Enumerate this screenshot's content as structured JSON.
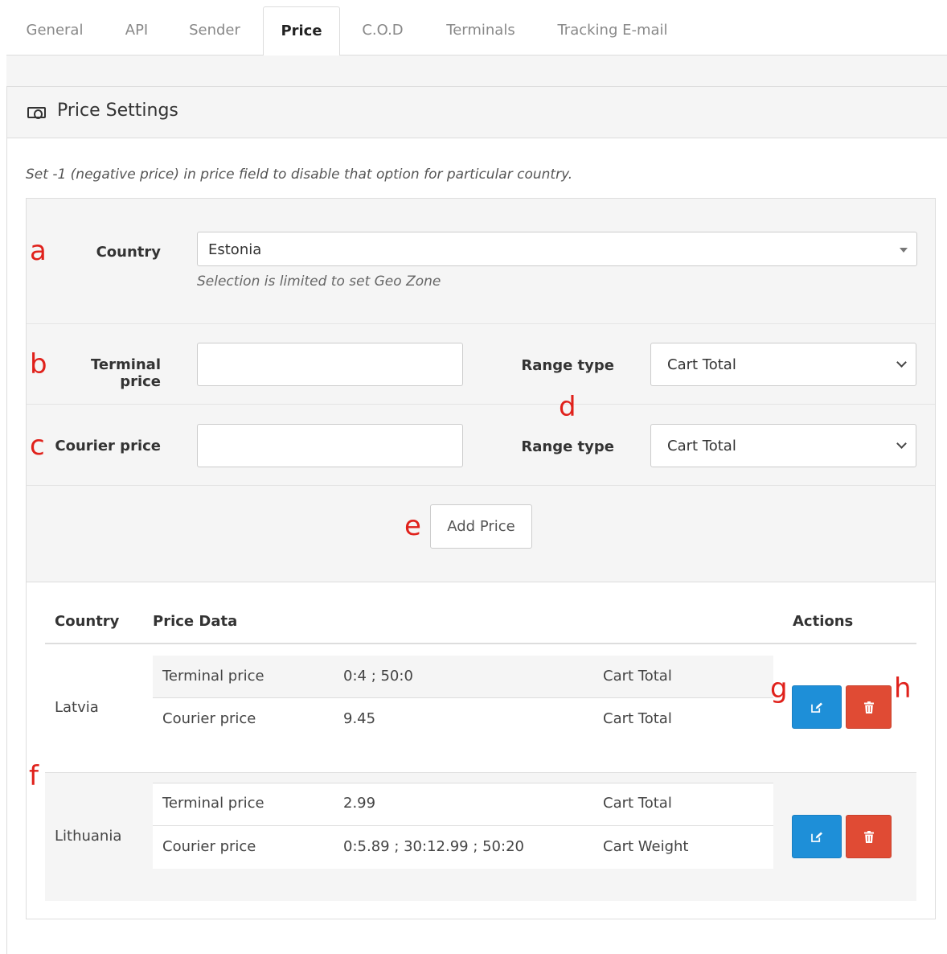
{
  "tabs": [
    {
      "label": "General",
      "active": false
    },
    {
      "label": "API",
      "active": false
    },
    {
      "label": "Sender",
      "active": false
    },
    {
      "label": "Price",
      "active": true
    },
    {
      "label": "C.O.D",
      "active": false
    },
    {
      "label": "Terminals",
      "active": false
    },
    {
      "label": "Tracking E-mail",
      "active": false
    }
  ],
  "panel": {
    "title": "Price Settings",
    "icon": "money-icon",
    "hint": "Set -1 (negative price) in price field to disable that option for particular country."
  },
  "form": {
    "country": {
      "label": "Country",
      "value": "Estonia",
      "help": "Selection is limited to set Geo Zone"
    },
    "terminal": {
      "label": "Terminal price",
      "value": "",
      "range_label": "Range type",
      "range_value": "Cart Total"
    },
    "courier": {
      "label": "Courier price",
      "value": "",
      "range_label": "Range type",
      "range_value": "Cart Total"
    },
    "add_button": "Add Price"
  },
  "markers": {
    "a": "a",
    "b": "b",
    "c": "c",
    "d": "d",
    "e": "e",
    "f": "f",
    "g": "g",
    "h": "h"
  },
  "table": {
    "headers": {
      "country": "Country",
      "price_data": "Price Data",
      "actions": "Actions"
    },
    "rows": [
      {
        "country": "Latvia",
        "prices": [
          {
            "type": "Terminal price",
            "data": "0:4 ; 50:0",
            "range": "Cart Total"
          },
          {
            "type": "Courier price",
            "data": "9.45",
            "range": "Cart Total"
          }
        ]
      },
      {
        "country": "Lithuania",
        "prices": [
          {
            "type": "Terminal price",
            "data": "2.99",
            "range": "Cart Total"
          },
          {
            "type": "Courier price",
            "data": "0:5.89 ; 30:12.99 ; 50:20",
            "range": "Cart Weight"
          }
        ]
      }
    ]
  },
  "colors": {
    "edit_button": "#1e8fd8",
    "delete_button": "#e04b34",
    "marker": "#e0211b"
  }
}
